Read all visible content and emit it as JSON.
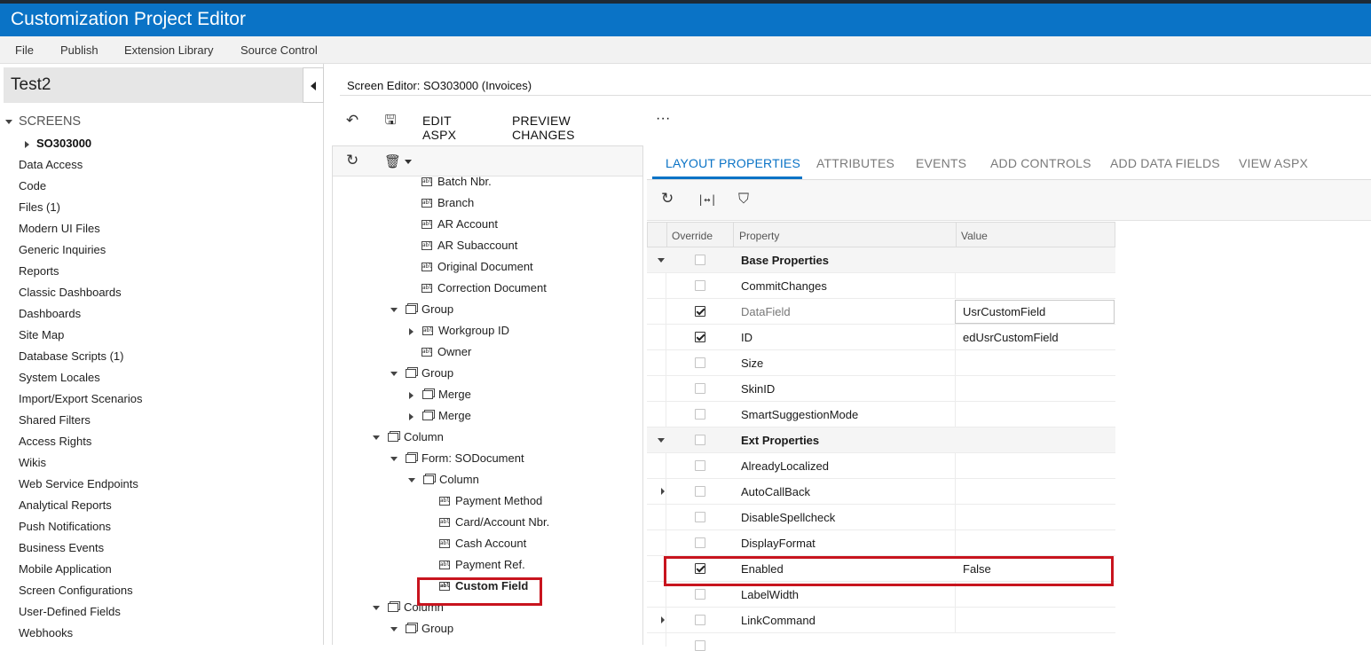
{
  "app": {
    "title": "Customization Project Editor"
  },
  "menu": [
    {
      "label": "File"
    },
    {
      "label": "Publish"
    },
    {
      "label": "Extension Library"
    },
    {
      "label": "Source Control"
    }
  ],
  "project": {
    "name": "Test2"
  },
  "nav": {
    "screens_label": "SCREENS",
    "screen_item": "SO303000",
    "items": [
      "Data Access",
      "Code",
      "Files (1)",
      "Modern UI Files",
      "Generic Inquiries",
      "Reports",
      "Classic Dashboards",
      "Dashboards",
      "Site Map",
      "Database Scripts (1)",
      "System Locales",
      "Import/Export Scenarios",
      "Shared Filters",
      "Access Rights",
      "Wikis",
      "Web Service Endpoints",
      "Analytical Reports",
      "Push Notifications",
      "Business Events",
      "Mobile Application",
      "Screen Configurations",
      "User-Defined Fields",
      "Webhooks"
    ]
  },
  "editor": {
    "header": "Screen Editor: SO303000 (Invoices)",
    "edit_aspx": "EDIT ASPX",
    "preview_changes": "PREVIEW CHANGES",
    "more": "···",
    "undo_icon": "↶",
    "save_icon": "🖫"
  },
  "tree": {
    "refresh_icon": "↻",
    "delete_icon": "🗑",
    "rows": [
      {
        "label": "Batch Nbr."
      },
      {
        "label": "Branch"
      },
      {
        "label": "AR Account"
      },
      {
        "label": "AR Subaccount"
      },
      {
        "label": "Original Document"
      },
      {
        "label": "Correction Document"
      },
      {
        "label": "Group"
      },
      {
        "label": "Workgroup ID"
      },
      {
        "label": "Owner"
      },
      {
        "label": "Group"
      },
      {
        "label": "Merge"
      },
      {
        "label": "Merge"
      },
      {
        "label": "Column"
      },
      {
        "label": "Form: SODocument"
      },
      {
        "label": "Column"
      },
      {
        "label": "Payment Method"
      },
      {
        "label": "Card/Account Nbr."
      },
      {
        "label": "Cash Account"
      },
      {
        "label": "Payment Ref."
      },
      {
        "label": "Custom Field"
      },
      {
        "label": "Column"
      },
      {
        "label": "Group"
      }
    ]
  },
  "tabs": [
    {
      "label": "LAYOUT PROPERTIES"
    },
    {
      "label": "ATTRIBUTES"
    },
    {
      "label": "EVENTS"
    },
    {
      "label": "ADD CONTROLS"
    },
    {
      "label": "ADD DATA FIELDS"
    },
    {
      "label": "VIEW ASPX"
    }
  ],
  "props": {
    "refresh_icon": "↻",
    "fit_icon": "|↔|",
    "filter_icon": "⛉",
    "headers": {
      "override": "Override",
      "property": "Property",
      "value": "Value"
    },
    "rows": [
      {
        "name": "Base Properties",
        "value": "",
        "checked": false
      },
      {
        "name": "CommitChanges",
        "value": "",
        "checked": false
      },
      {
        "name": "DataField",
        "value": "UsrCustomField",
        "checked": true
      },
      {
        "name": "ID",
        "value": "edUsrCustomField",
        "checked": true
      },
      {
        "name": "Size",
        "value": "",
        "checked": false
      },
      {
        "name": "SkinID",
        "value": "",
        "checked": false
      },
      {
        "name": "SmartSuggestionMode",
        "value": "",
        "checked": false
      },
      {
        "name": "Ext Properties",
        "value": "",
        "checked": false
      },
      {
        "name": "AlreadyLocalized",
        "value": "",
        "checked": false
      },
      {
        "name": "AutoCallBack",
        "value": "",
        "checked": false
      },
      {
        "name": "DisableSpellcheck",
        "value": "",
        "checked": false
      },
      {
        "name": "DisplayFormat",
        "value": "",
        "checked": false
      },
      {
        "name": "Enabled",
        "value": "False",
        "checked": true
      },
      {
        "name": "LabelWidth",
        "value": "",
        "checked": false
      },
      {
        "name": "LinkCommand",
        "value": "",
        "checked": false
      }
    ]
  },
  "colors": {
    "brand": "#0a73c6",
    "highlight": "#c8141e"
  }
}
